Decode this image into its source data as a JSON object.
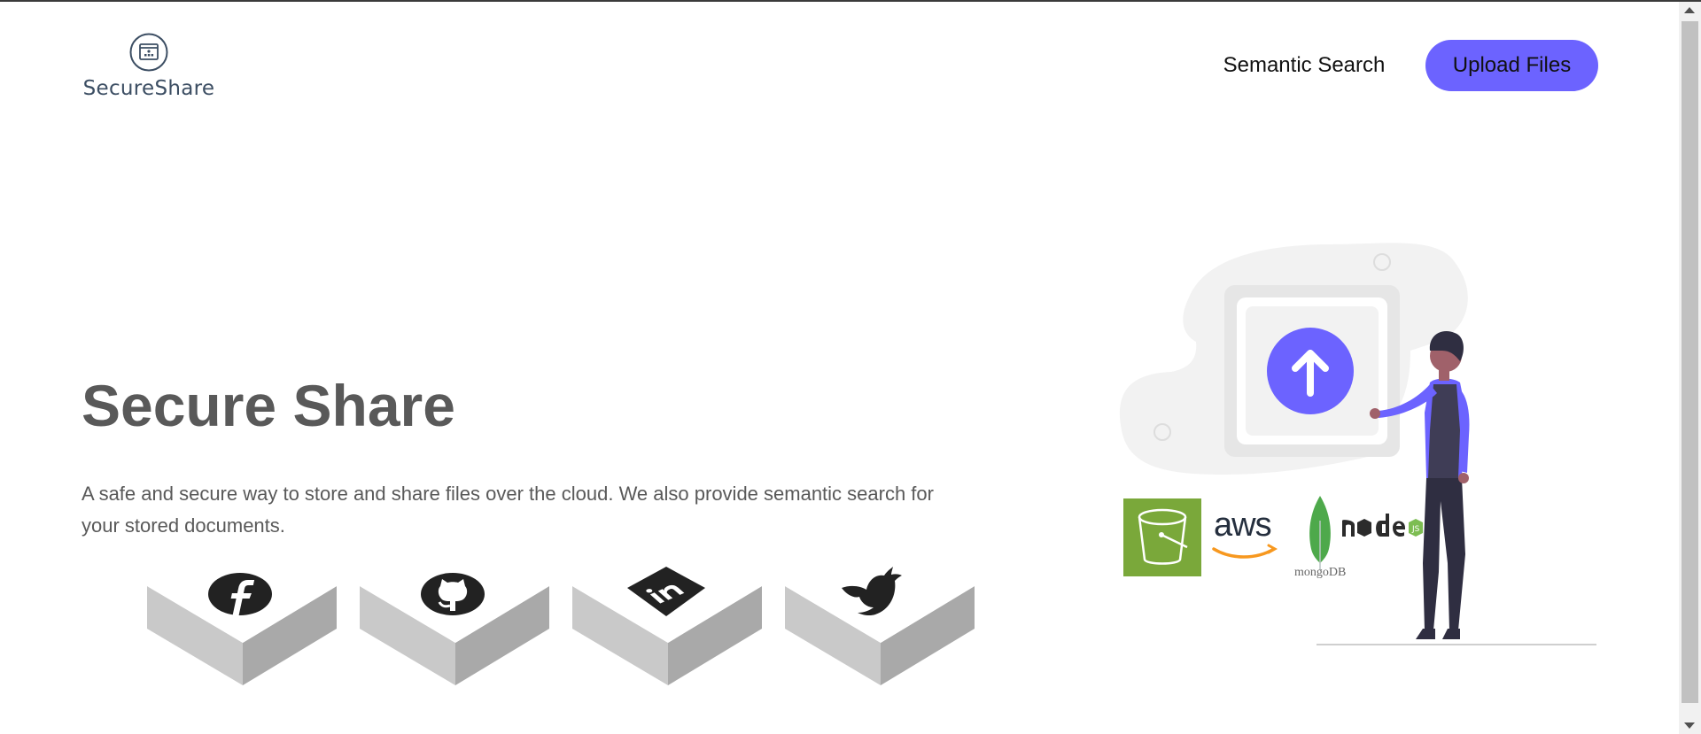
{
  "header": {
    "logo_text": "SecureShare",
    "nav_link": "Semantic Search",
    "upload_button": "Upload Files"
  },
  "hero": {
    "title": "Secure Share",
    "description": "A safe and secure way to store and share files over the cloud. We also provide semantic search for your stored documents."
  },
  "socials": [
    {
      "name": "facebook-icon"
    },
    {
      "name": "github-icon"
    },
    {
      "name": "linkedin-icon"
    },
    {
      "name": "twitter-icon"
    }
  ],
  "tech": {
    "aws_label": "aws",
    "mongo_label": "mongoDB"
  },
  "colors": {
    "accent": "#6c63ff",
    "text": "#595959",
    "s3_green": "#7aa83a",
    "aws_orange": "#f7981f",
    "mongo_green": "#4ea94b"
  }
}
